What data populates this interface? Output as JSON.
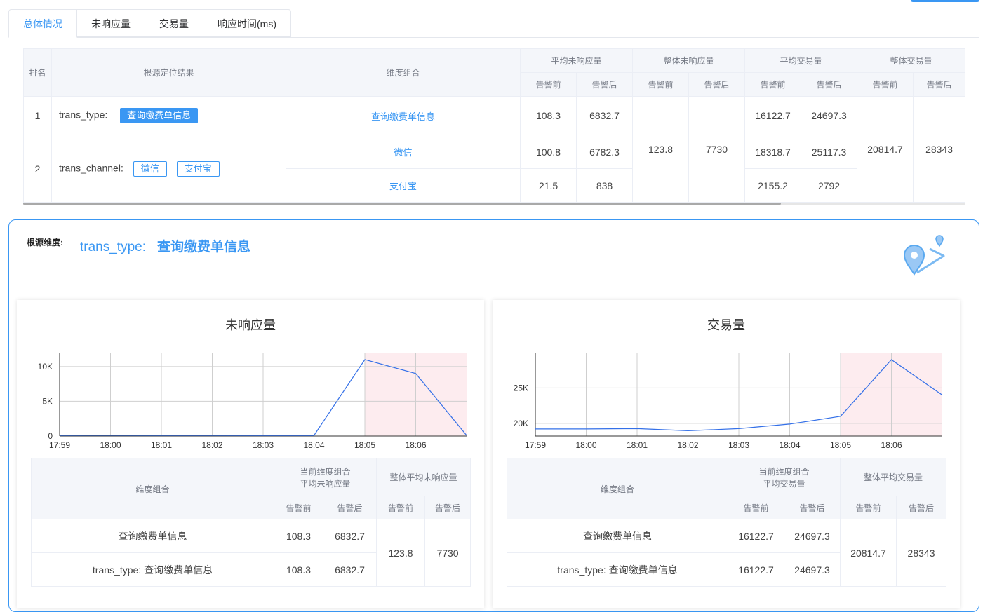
{
  "tabs": [
    "总体情况",
    "未响应量",
    "交易量",
    "响应时间(ms)"
  ],
  "main_table": {
    "headers": {
      "rank": "排名",
      "result": "根源定位结果",
      "dimension": "维度组合",
      "avg_unresp": "平均未响应量",
      "total_unresp": "整体未响应量",
      "avg_trade": "平均交易量",
      "total_trade": "整体交易量",
      "before": "告警前",
      "after": "告警后"
    },
    "rows": [
      {
        "rank": "1",
        "field": "trans_type:",
        "tags": [
          "查询缴费单信息"
        ],
        "dims": [
          {
            "name": "查询缴费单信息",
            "unresp_before": "108.3",
            "unresp_after": "6832.7",
            "trade_before": "16122.7",
            "trade_after": "24697.3"
          }
        ]
      },
      {
        "rank": "2",
        "field": "trans_channel:",
        "tags": [
          "微信",
          "支付宝"
        ],
        "dims": [
          {
            "name": "微信",
            "unresp_before": "100.8",
            "unresp_after": "6782.3",
            "trade_before": "18318.7",
            "trade_after": "25117.3"
          },
          {
            "name": "支付宝",
            "unresp_before": "21.5",
            "unresp_after": "838",
            "trade_before": "2155.2",
            "trade_after": "2792"
          }
        ]
      }
    ],
    "total_unresp_before": "123.8",
    "total_unresp_after": "7730",
    "total_trade_before": "20814.7",
    "total_trade_after": "28343"
  },
  "detail": {
    "root_label": "根源维度:",
    "root_field": "trans_type:",
    "root_value": "查询缴费单信息"
  },
  "colors": {
    "accent": "#3a97f3",
    "alarm_zone": "#fdecef",
    "line": "#3470e8"
  },
  "chart_data": [
    {
      "type": "line",
      "title": "未响应量",
      "categories": [
        "17:59",
        "18:00",
        "18:01",
        "18:02",
        "18:03",
        "18:04",
        "18:05",
        "18:06",
        "18:07"
      ],
      "x_tick_labels": [
        "17:59",
        "18:00",
        "18:01",
        "18:02",
        "18:03",
        "18:04",
        "18:05",
        "18:06"
      ],
      "values": [
        100,
        110,
        105,
        100,
        95,
        90,
        11000,
        9000,
        100
      ],
      "y_ticks": [
        0,
        5000,
        10000
      ],
      "y_tick_labels": [
        "0",
        "5K",
        "10K"
      ],
      "ylim": [
        0,
        12000
      ],
      "alarm_region": [
        "18:05",
        "18:07"
      ],
      "table": {
        "h_dim": "维度组合",
        "h_current": [
          "当前维度组合",
          "平均未响应量"
        ],
        "h_overall": "整体平均未响应量",
        "before": "告警前",
        "after": "告警后",
        "rows": [
          {
            "dim": "查询缴费单信息",
            "before": "108.3",
            "after": "6832.7"
          },
          {
            "dim": "trans_type: 查询缴费单信息",
            "before": "108.3",
            "after": "6832.7"
          }
        ],
        "overall_before": "123.8",
        "overall_after": "7730"
      }
    },
    {
      "type": "line",
      "title": "交易量",
      "categories": [
        "17:59",
        "18:00",
        "18:01",
        "18:02",
        "18:03",
        "18:04",
        "18:05",
        "18:06",
        "18:07"
      ],
      "x_tick_labels": [
        "17:59",
        "18:00",
        "18:01",
        "18:02",
        "18:03",
        "18:04",
        "18:05",
        "18:06"
      ],
      "values": [
        19200,
        19200,
        19250,
        18950,
        19250,
        19900,
        21000,
        29000,
        24000
      ],
      "y_ticks": [
        20000,
        25000
      ],
      "y_tick_labels": [
        "20K",
        "25K"
      ],
      "ylim": [
        18200,
        30000
      ],
      "alarm_region": [
        "18:05",
        "18:07"
      ],
      "table": {
        "h_dim": "维度组合",
        "h_current": [
          "当前维度组合",
          "平均交易量"
        ],
        "h_overall": "整体平均交易量",
        "before": "告警前",
        "after": "告警后",
        "rows": [
          {
            "dim": "查询缴费单信息",
            "before": "16122.7",
            "after": "24697.3"
          },
          {
            "dim": "trans_type: 查询缴费单信息",
            "before": "16122.7",
            "after": "24697.3"
          }
        ],
        "overall_before": "20814.7",
        "overall_after": "28343"
      }
    }
  ]
}
